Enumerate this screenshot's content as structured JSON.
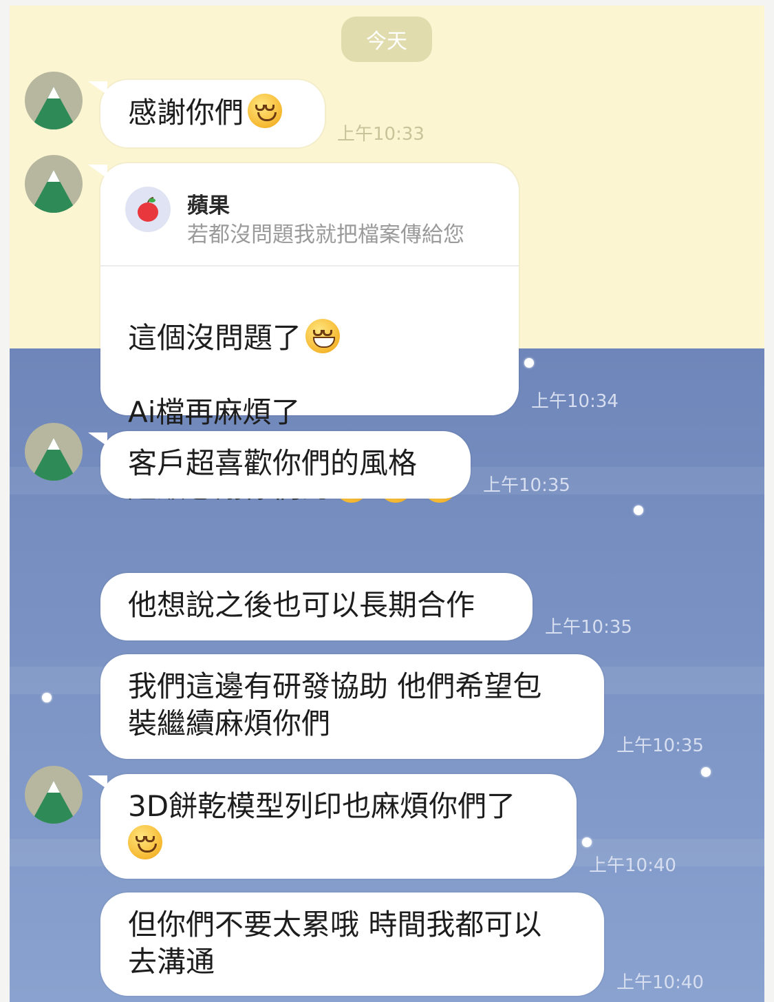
{
  "date_label": "今天",
  "avatar_icon": "mountain-icon",
  "colors": {
    "top_background": "#fbf5d2",
    "bottom_background": "#7a92c3",
    "bubble": "#ffffff",
    "date_badge": "#e1dcae",
    "timestamp": "#c9c39a"
  },
  "messages": [
    {
      "text": "感謝你們",
      "emoji": "smiling-face",
      "time": "上午10:33"
    },
    {
      "reply_to": {
        "name": "蘋果",
        "quote": "若都沒問題我就把檔案傳給您",
        "icon": "apple-icon"
      },
      "lines": [
        "這個沒問題了",
        "Ai檔再麻煩了",
        "超級感謝你們的"
      ],
      "line1_emoji": "grinning-face",
      "line3_emojis": [
        "pleading-face",
        "pleading-face",
        "pleading-face"
      ],
      "time": "上午10:34"
    },
    {
      "text": "客戶超喜歡你們的風格",
      "time": "上午10:35"
    },
    {
      "text": "他想說之後也可以長期合作",
      "time": "上午10:35"
    },
    {
      "text": "我們這邊有研發協助 他們希望包\n裝繼續麻煩你們",
      "time": "上午10:35"
    },
    {
      "text": "3D餅乾模型列印也麻煩你們了",
      "emoji": "smiling-face",
      "time": "上午10:40"
    },
    {
      "text": "但你們不要太累哦 時間我都可以\n去溝通",
      "time": "上午10:40"
    }
  ]
}
